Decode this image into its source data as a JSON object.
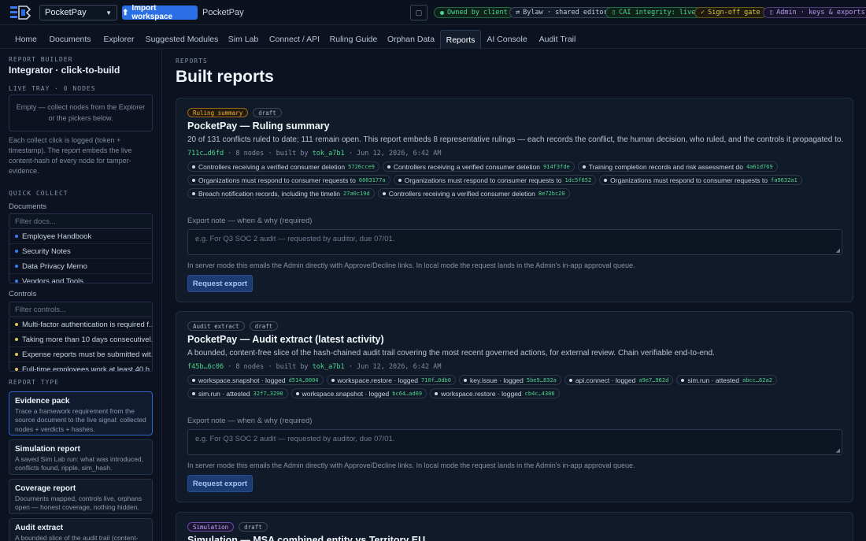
{
  "topbar": {
    "workspace_select": "PocketPay",
    "import_label": "Import workspace",
    "workspace_name": "PocketPay",
    "pills": {
      "owned": "Owned by client",
      "bylaw": "Bylaw · shared editor",
      "integrity": "CAI integrity: live",
      "signoff": "Sign-off gate",
      "admin": "Admin · keys & exports"
    }
  },
  "nav": {
    "tabs": [
      "Home",
      "Documents",
      "Explorer",
      "Suggested Modules",
      "Sim Lab",
      "Connect / API",
      "Ruling Guide",
      "Orphan Data",
      "Reports",
      "AI Console",
      "Audit Trail"
    ],
    "active": "Reports"
  },
  "sidebar": {
    "kicker": "REPORT BUILDER",
    "title": "Integrator · click-to-build",
    "tray_label": "LIVE TRAY · 0 NODES",
    "tray_empty": "Empty — collect nodes from the Explorer or the pickers below.",
    "help": "Each collect click is logged (token + timestamp). The report embeds the live content-hash of every node for tamper-evidence.",
    "quick_collect": "QUICK COLLECT",
    "documents_label": "Documents",
    "documents_placeholder": "Filter docs...",
    "documents": [
      "Employee Handbook",
      "Security Notes",
      "Data Privacy Memo",
      "Vendors and Tools"
    ],
    "controls_label": "Controls",
    "controls_placeholder": "Filter controls...",
    "controls": [
      "Multi-factor authentication is required f...",
      "Taking more than 10 days consecutivel...",
      "Expense reports must be submitted wit...",
      "Full-time employees work at least 40 h..."
    ],
    "report_type_label": "REPORT TYPE",
    "report_types": [
      {
        "title": "Evidence pack",
        "desc": "Trace a framework requirement from the source document to the live signal: collected nodes + verdicts + hashes."
      },
      {
        "title": "Simulation report",
        "desc": "A saved Sim Lab run: what was introduced, conflicts found, ripple, sim_hash."
      },
      {
        "title": "Coverage report",
        "desc": "Documents mapped, controls live, orphans open — honest coverage, nothing hidden."
      },
      {
        "title": "Audit extract",
        "desc": "A bounded slice of the audit trail (content-"
      }
    ]
  },
  "main": {
    "kicker": "REPORTS",
    "title": "Built reports",
    "reports": [
      {
        "type_badge": "Ruling summary",
        "status": "draft",
        "title": "PocketPay — Ruling summary",
        "desc": "20 of 131 conflicts ruled to date; 111 remain open. This report embeds 8 representative rulings — each records the conflict, the human decision, who ruled, and the controls it propagated to.",
        "hash": "711c…d6fd",
        "nodes": "8 nodes",
        "built_by": "built by",
        "token": "tok_a7b1",
        "date": "Jun 12, 2026, 6:42 AM",
        "chips": [
          {
            "label": "Controllers receiving a verified consumer deletion",
            "hash": "5726cce9"
          },
          {
            "label": "Controllers receiving a verified consumer deletion",
            "hash": "914f3fde"
          },
          {
            "label": "Training completion records and risk assessment do",
            "hash": "4a61d769"
          },
          {
            "label": "Organizations must respond to consumer requests to",
            "hash": "6003177a"
          },
          {
            "label": "Organizations must respond to consumer requests to",
            "hash": "1dc5f652"
          },
          {
            "label": "Organizations must respond to consumer requests to",
            "hash": "fa9632a1"
          },
          {
            "label": "Breach notification records, including the timelin",
            "hash": "27a0c19d"
          },
          {
            "label": "Controllers receiving a verified consumer deletion",
            "hash": "8e72bc20"
          }
        ],
        "note_label": "Export note — when & why (required)",
        "note_placeholder": "e.g. For Q3 SOC 2 audit — requested by auditor, due 07/01.",
        "note_help": "In server mode this emails the Admin directly with Approve/Decline links. In local mode the request lands in the Admin's in-app approval queue.",
        "button": "Request export"
      },
      {
        "type_badge": "Audit extract",
        "status": "draft",
        "title": "PocketPay — Audit extract (latest activity)",
        "desc": "A bounded, content-free slice of the hash-chained audit trail covering the most recent governed actions, for external review. Chain verifiable end-to-end.",
        "hash": "f45b…6c06",
        "nodes": "8 nodes",
        "built_by": "built by",
        "token": "tok_a7b1",
        "date": "Jun 12, 2026, 6:42 AM",
        "chips": [
          {
            "label": "workspace.snapshot · logged",
            "hash": "d514…0004"
          },
          {
            "label": "workspace.restore · logged",
            "hash": "710f…0db0"
          },
          {
            "label": "key.issue · logged",
            "hash": "5be9…832a"
          },
          {
            "label": "api.connect · logged",
            "hash": "a9e7…962d"
          },
          {
            "label": "sim.run · attested",
            "hash": "abcc…62a2"
          },
          {
            "label": "sim.run · attested",
            "hash": "32f7…3290"
          },
          {
            "label": "workspace.snapshot · logged",
            "hash": "bc64…ad69"
          },
          {
            "label": "workspace.restore · logged",
            "hash": "cb4c…4306"
          }
        ],
        "note_label": "Export note — when & why (required)",
        "note_placeholder": "e.g. For Q3 SOC 2 audit — requested by auditor, due 07/01.",
        "note_help": "In server mode this emails the Admin directly with Approve/Decline links. In local mode the request lands in the Admin's in-app approval queue.",
        "button": "Request export"
      },
      {
        "type_badge": "Simulation",
        "status": "draft",
        "title": "Simulation — MSA combined entity vs Territory EU"
      }
    ]
  },
  "colors": {
    "accent": "#2b6fe6",
    "hash_green": "#4fd38c",
    "bg": "#0c1220"
  }
}
